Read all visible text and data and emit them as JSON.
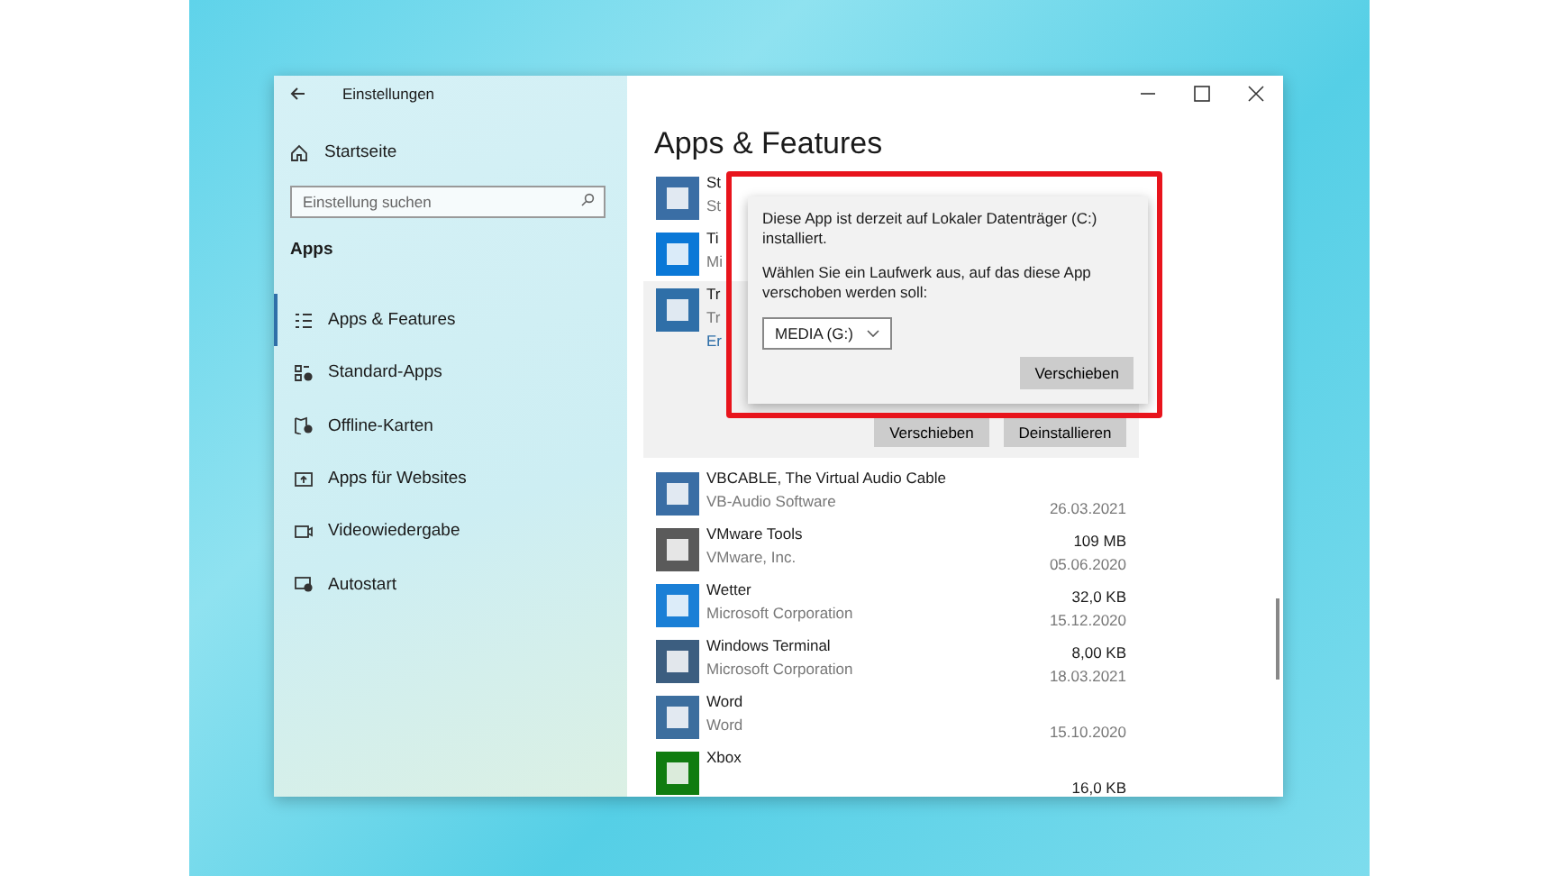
{
  "window": {
    "title": "Einstellungen"
  },
  "sidebar": {
    "home": "Startseite",
    "search": {
      "placeholder": "Einstellung suchen"
    },
    "section": "Apps",
    "items": [
      {
        "label": "Apps & Features",
        "selected": true
      },
      {
        "label": "Standard-Apps",
        "selected": false
      },
      {
        "label": "Offline-Karten",
        "selected": false
      },
      {
        "label": "Apps für Websites",
        "selected": false
      },
      {
        "label": "Videowiedergabe",
        "selected": false
      },
      {
        "label": "Autostart",
        "selected": false
      }
    ]
  },
  "main": {
    "heading": "Apps & Features",
    "apps": [
      {
        "name": "St",
        "publisher": "St",
        "expanded": false
      },
      {
        "name": "Ti",
        "publisher": "Mi",
        "expanded": false
      },
      {
        "name": "Tr",
        "publisher": "Tr",
        "link": "Er",
        "expanded": true,
        "buttons": [
          "Verschieben",
          "Deinstallieren"
        ]
      },
      {
        "name": "VBCABLE, The Virtual Audio Cable",
        "publisher": "VB-Audio Software",
        "date": "26.03.2021",
        "expanded": false
      },
      {
        "name": "VMware Tools",
        "publisher": "VMware, Inc.",
        "size": "109 MB",
        "date": "05.06.2020",
        "expanded": false
      },
      {
        "name": "Wetter",
        "publisher": "Microsoft Corporation",
        "size": "32,0 KB",
        "date": "15.12.2020",
        "expanded": false
      },
      {
        "name": "Windows Terminal",
        "publisher": "Microsoft Corporation",
        "size": "8,00 KB",
        "date": "18.03.2021",
        "expanded": false
      },
      {
        "name": "Word",
        "publisher": "Word",
        "date": "15.10.2020",
        "expanded": false
      },
      {
        "name": "Xbox",
        "size": "16,0 KB",
        "expanded": false
      }
    ]
  },
  "popup": {
    "message": "Diese App ist derzeit auf Lokaler Datenträger (C:) installiert.",
    "prompt": "Wählen Sie ein Laufwerk aus, auf das diese App verschoben werden soll:",
    "drive": "MEDIA (G:)",
    "button": "Verschieben"
  }
}
